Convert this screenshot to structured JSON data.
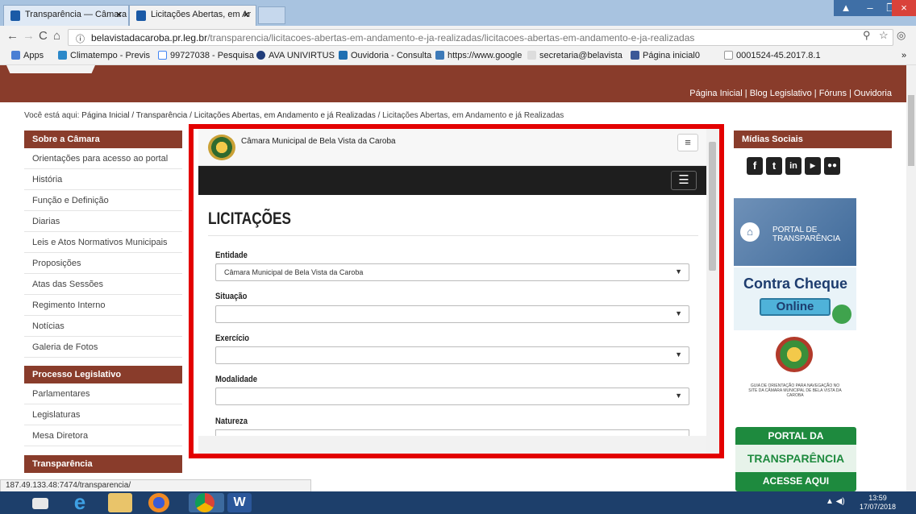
{
  "browser": {
    "tabs": [
      {
        "label": "Transparência — Câmara",
        "close": "×"
      },
      {
        "label": "Licitações Abertas, em Ar",
        "close": "×"
      }
    ],
    "url_host": "belavistadacaroba.pr.leg.br",
    "url_path": "/transparencia/licitacoes-abertas-em-andamento-e-ja-realizadas/licitacoes-abertas-em-andamento-e-ja-realizadas",
    "bookmarks": [
      "Apps",
      "Climatempo - Previs",
      "99727038 - Pesquisa",
      "AVA UNIVIRTUS",
      "Ouvidoria - Consulta",
      "https://www.google",
      "secretaria@belavista",
      "Página inicial0",
      "0001524-45.2017.8.1"
    ],
    "status_url": "187.49.133.48:7474/transparencia/"
  },
  "site": {
    "top_nav": "Página Inicial  |  Blog Legislativo  |  Fóruns  |  Ouvidoria",
    "breadcrumb_prefix": "Você está aqui:",
    "breadcrumb_links": "Página Inicial / Transparência / Licitações Abertas, em Andamento e já Realizadas",
    "breadcrumb_current": "/ Licitações Abertas, em Andamento e já Realizadas",
    "sidebar": {
      "sections": [
        {
          "title": "Sobre a Câmara",
          "items": [
            "Orientações para acesso ao portal",
            "História",
            "Função e Definição",
            "Diarias",
            "Leis e Atos Normativos Municipais",
            "Proposições",
            "Atas das Sessões",
            "Regimento Interno",
            "Notícias",
            "Galeria de Fotos"
          ]
        },
        {
          "title": "Processo Legislativo",
          "items": [
            "Parlamentares",
            "Legislaturas",
            "Mesa Diretora"
          ]
        },
        {
          "title": "Transparência",
          "items": []
        }
      ]
    },
    "right": {
      "social_title": "Mídias Sociais",
      "portal_transparencia": "PORTAL DE TRANSPARÊNCIA",
      "contra_cheque": "Contra Cheque",
      "online": "Online",
      "guia": "GUIA DE ORIENTAÇÃO PARA NAVEGAÇÃO NO SITE DA CÂMARA MUNICIPAL DE BELA VISTA DA CAROBA",
      "portal_da": "PORTAL DA",
      "transparencia": "TRANSPARÊNCIA",
      "acesse": "ACESSE AQUI"
    }
  },
  "frame": {
    "org_name": "Câmara Municipal de Bela Vista da Caroba",
    "title": "LICITAÇÕES",
    "fields": [
      {
        "label": "Entidade",
        "value": "Câmara Municipal de Bela Vista da Caroba"
      },
      {
        "label": "Situação",
        "value": ""
      },
      {
        "label": "Exercício",
        "value": ""
      },
      {
        "label": "Modalidade",
        "value": ""
      },
      {
        "label": "Natureza",
        "value": ""
      }
    ]
  },
  "taskbar": {
    "time": "13:59",
    "date": "17/07/2018"
  }
}
